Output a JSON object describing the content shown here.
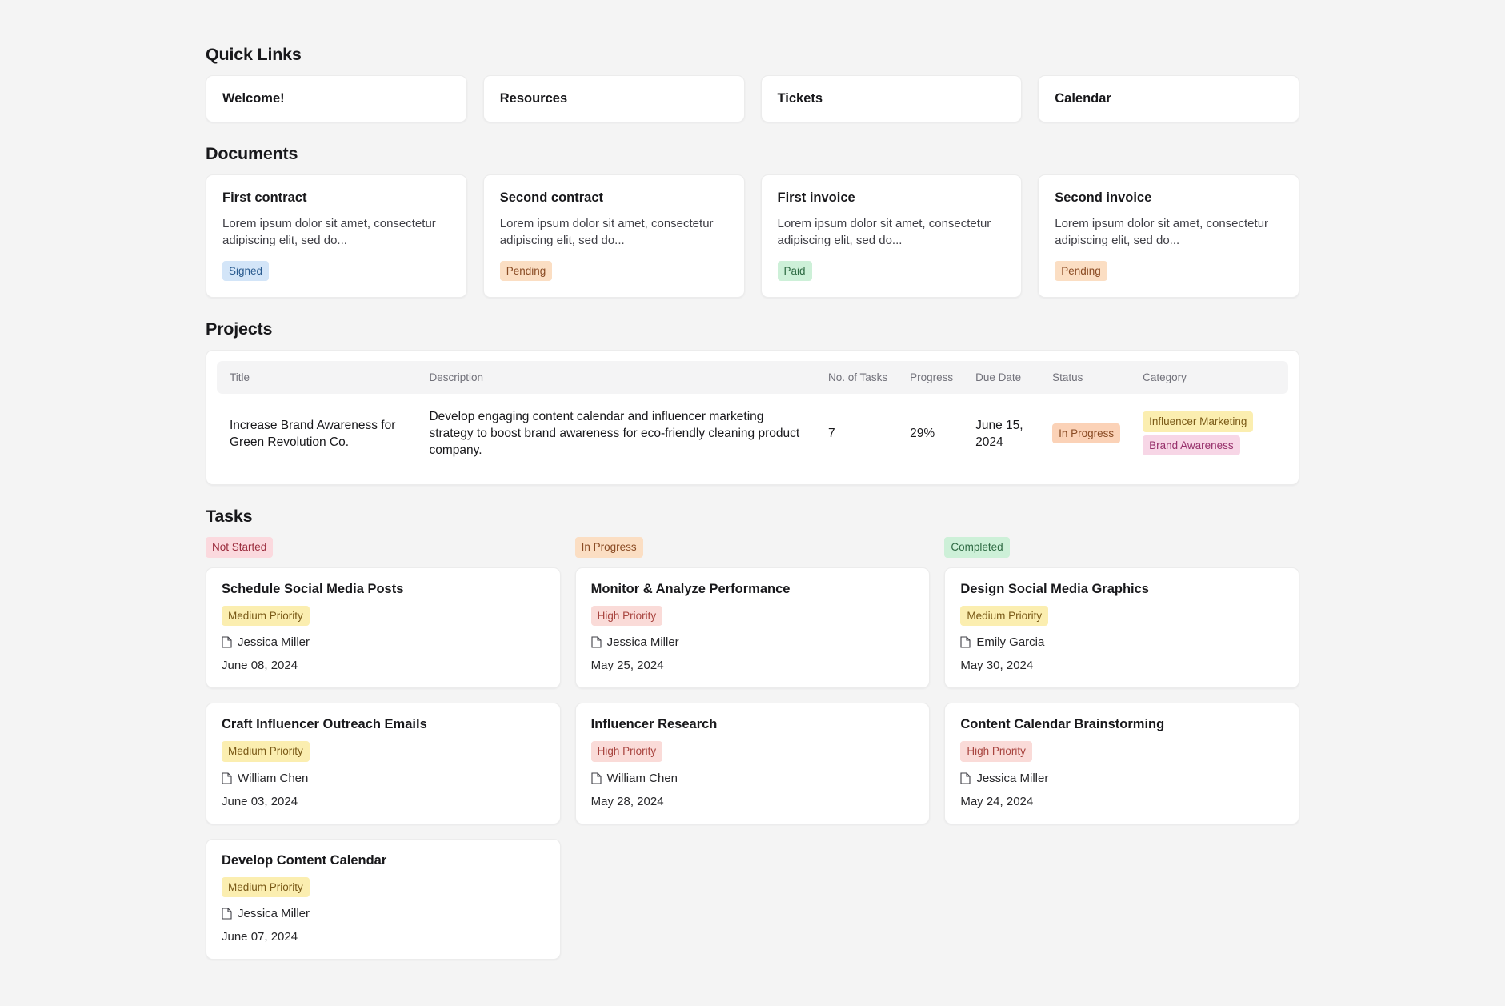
{
  "quick_links": {
    "heading": "Quick Links",
    "items": [
      {
        "label": "Welcome!"
      },
      {
        "label": "Resources"
      },
      {
        "label": "Tickets"
      },
      {
        "label": "Calendar"
      }
    ]
  },
  "documents": {
    "heading": "Documents",
    "items": [
      {
        "title": "First contract",
        "description": "Lorem ipsum dolor sit amet, consectetur adipiscing elit, sed do...",
        "status": "Signed",
        "status_color": "#d3e5f8"
      },
      {
        "title": "Second contract",
        "description": "Lorem ipsum dolor sit amet, consectetur adipiscing elit, sed do...",
        "status": "Pending",
        "status_color": "#fbdec3"
      },
      {
        "title": "First invoice",
        "description": "Lorem ipsum dolor sit amet, consectetur adipiscing elit, sed do...",
        "status": "Paid",
        "status_color": "#cdf0d8"
      },
      {
        "title": "Second invoice",
        "description": "Lorem ipsum dolor sit amet, consectetur adipiscing elit, sed do...",
        "status": "Pending",
        "status_color": "#fbdec3"
      }
    ]
  },
  "projects": {
    "heading": "Projects",
    "columns": [
      "Title",
      "Description",
      "No. of Tasks",
      "Progress",
      "Due Date",
      "Status",
      "Category"
    ],
    "rows": [
      {
        "title": "Increase Brand Awareness for Green Revolution Co.",
        "description": "Develop engaging content calendar and influencer marketing strategy to boost brand awareness for eco-friendly cleaning product company.",
        "num_tasks": "7",
        "progress": "29%",
        "due_date": "June 15, 2024",
        "status": "In Progress",
        "status_color": "#fbd2b7",
        "categories": [
          {
            "label": "Influencer Marketing",
            "color": "#fbeeb0"
          },
          {
            "label": "Brand Awareness",
            "color": "#f7d6e6"
          }
        ]
      }
    ]
  },
  "tasks": {
    "heading": "Tasks",
    "columns": [
      {
        "status": "Not Started",
        "status_color": "#fbd9de",
        "cards": [
          {
            "title": "Schedule Social Media Posts",
            "priority": "Medium Priority",
            "priority_color": "#fbeeb0",
            "assignee": "Jessica Miller",
            "assignee_icon": "page-icon",
            "date": "June 08, 2024"
          },
          {
            "title": "Craft Influencer Outreach Emails",
            "priority": "Medium Priority",
            "priority_color": "#fbeeb0",
            "assignee": "William Chen",
            "assignee_icon": "page-icon",
            "date": "June 03, 2024"
          },
          {
            "title": "Develop Content Calendar",
            "priority": "Medium Priority",
            "priority_color": "#fbeeb0",
            "assignee": "Jessica Miller",
            "assignee_icon": "page-icon",
            "date": "June 07, 2024"
          }
        ]
      },
      {
        "status": "In Progress",
        "status_color": "#fbdec3",
        "cards": [
          {
            "title": "Monitor & Analyze Performance",
            "priority": "High Priority",
            "priority_color": "#fadbd8",
            "assignee": "Jessica Miller",
            "assignee_icon": "page-icon",
            "date": "May 25, 2024"
          },
          {
            "title": "Influencer Research",
            "priority": "High Priority",
            "priority_color": "#fadbd8",
            "assignee": "William Chen",
            "assignee_icon": "page-icon",
            "date": "May 28, 2024"
          }
        ]
      },
      {
        "status": "Completed",
        "status_color": "#cdf0d8",
        "cards": [
          {
            "title": "Design Social Media Graphics",
            "priority": "Medium Priority",
            "priority_color": "#fbeeb0",
            "assignee": "Emily Garcia",
            "assignee_icon": "page-icon",
            "date": "May 30, 2024"
          },
          {
            "title": "Content Calendar Brainstorming",
            "priority": "High Priority",
            "priority_color": "#fadbd8",
            "assignee": "Jessica Miller",
            "assignee_icon": "page-icon",
            "date": "May 24, 2024"
          }
        ]
      }
    ]
  }
}
